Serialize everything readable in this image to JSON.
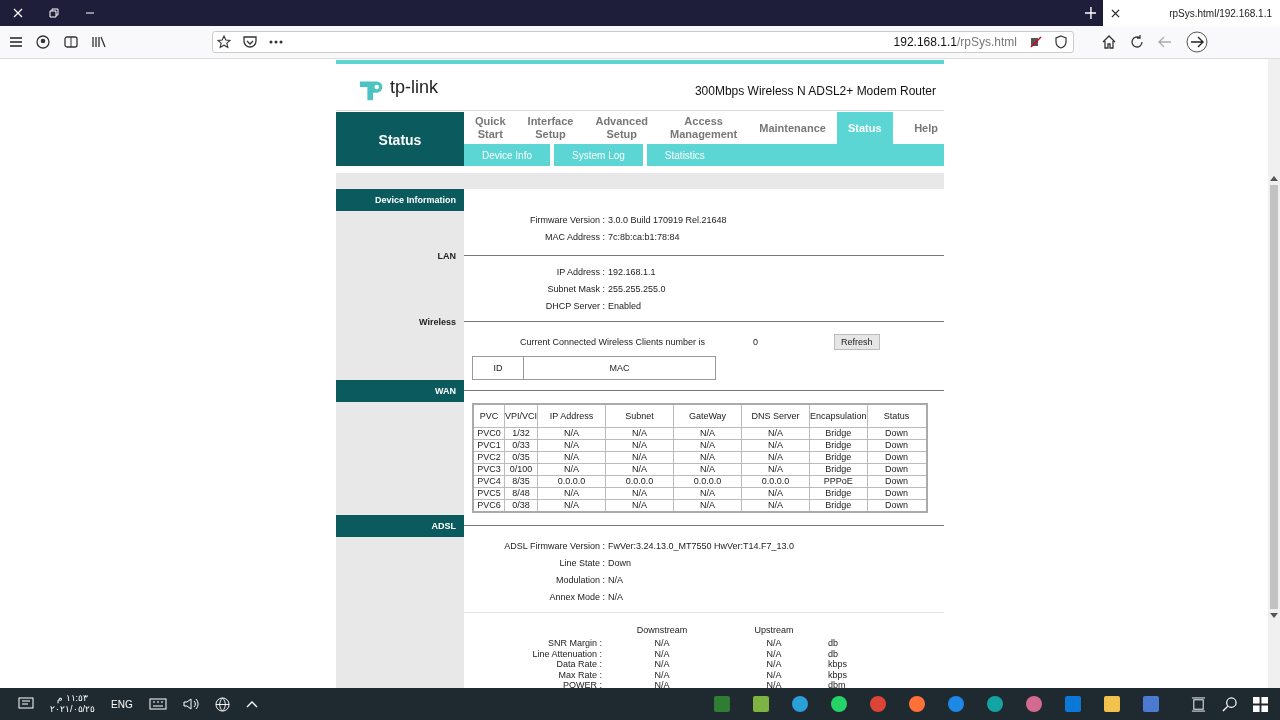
{
  "browser": {
    "tab_title": "rpSys.html/192.168.1.1",
    "url_host": "192.168.1.1",
    "url_path": "/rpSys.html"
  },
  "router": {
    "logo": "tp-link",
    "model": "300Mbps Wireless N ADSL2+ Modem Router",
    "section_title": "Status",
    "nav": [
      {
        "label": "Quick Start",
        "selected": false
      },
      {
        "label": "Interface Setup",
        "selected": false
      },
      {
        "label": "Advanced Setup",
        "selected": false
      },
      {
        "label": "Access Management",
        "selected": false
      },
      {
        "label": "Maintenance",
        "selected": false
      },
      {
        "label": "Status",
        "selected": true
      },
      {
        "label": "Help",
        "selected": false
      }
    ],
    "subnav": [
      "Device Info",
      "System Log",
      "Statistics"
    ]
  },
  "device_information": {
    "title": "Device Information",
    "kind": "bar",
    "fields": [
      {
        "label": "Firmware Version :",
        "value": "3.0.0 Build 170919 Rel.21648"
      },
      {
        "label": "MAC Address :",
        "value": "7c:8b:ca:b1:78:84"
      }
    ]
  },
  "lan": {
    "title": "LAN",
    "kind": "plain",
    "fields": [
      {
        "label": "IP Address :",
        "value": "192.168.1.1"
      },
      {
        "label": "Subnet Mask :",
        "value": "255.255.255.0"
      },
      {
        "label": "DHCP Server :",
        "value": "Enabled"
      }
    ]
  },
  "wireless": {
    "title": "Wireless",
    "kind": "plain",
    "clients_label": "Current Connected Wireless Clients number is",
    "clients_count": "0",
    "refresh_button": "Refresh",
    "columns": [
      "ID",
      "MAC"
    ]
  },
  "wan": {
    "title": "WAN",
    "kind": "bar",
    "columns": [
      "PVC",
      "VPI/VCI",
      "IP Address",
      "Subnet",
      "GateWay",
      "DNS Server",
      "Encapsulation",
      "Status"
    ],
    "rows": [
      [
        "PVC0",
        "1/32",
        "N/A",
        "N/A",
        "N/A",
        "N/A",
        "Bridge",
        "Down"
      ],
      [
        "PVC1",
        "0/33",
        "N/A",
        "N/A",
        "N/A",
        "N/A",
        "Bridge",
        "Down"
      ],
      [
        "PVC2",
        "0/35",
        "N/A",
        "N/A",
        "N/A",
        "N/A",
        "Bridge",
        "Down"
      ],
      [
        "PVC3",
        "0/100",
        "N/A",
        "N/A",
        "N/A",
        "N/A",
        "Bridge",
        "Down"
      ],
      [
        "PVC4",
        "8/35",
        "0.0.0.0",
        "0.0.0.0",
        "0.0.0.0",
        "0.0.0.0",
        "PPPoE",
        "Down"
      ],
      [
        "PVC5",
        "8/48",
        "N/A",
        "N/A",
        "N/A",
        "N/A",
        "Bridge",
        "Down"
      ],
      [
        "PVC6",
        "0/38",
        "N/A",
        "N/A",
        "N/A",
        "N/A",
        "Bridge",
        "Down"
      ]
    ]
  },
  "adsl": {
    "title": "ADSL",
    "kind": "bar",
    "fields": [
      {
        "label": "ADSL Firmware Version :",
        "value": "FwVer:3.24.13.0_MT7550 HwVer:T14.F7_13.0"
      },
      {
        "label": "Line State :",
        "value": "Down"
      },
      {
        "label": "Modulation :",
        "value": "N/A"
      },
      {
        "label": "Annex Mode :",
        "value": "N/A"
      }
    ],
    "stats_columns": [
      "Downstream",
      "Upstream"
    ],
    "stats": [
      {
        "label": "SNR Margin :",
        "down": "N/A",
        "up": "N/A",
        "unit": "db"
      },
      {
        "label": "Line Attenuation :",
        "down": "N/A",
        "up": "N/A",
        "unit": "db"
      },
      {
        "label": "Data Rate :",
        "down": "N/A",
        "up": "N/A",
        "unit": "kbps"
      },
      {
        "label": "Max Rate :",
        "down": "N/A",
        "up": "N/A",
        "unit": "kbps"
      },
      {
        "label": "POWER :",
        "down": "N/A",
        "up": "N/A",
        "unit": "dbm"
      }
    ]
  },
  "taskbar": {
    "language": "ENG",
    "time": "١١:٥٣ م",
    "date": "٢٠٢١/٠٥/٢٥"
  }
}
